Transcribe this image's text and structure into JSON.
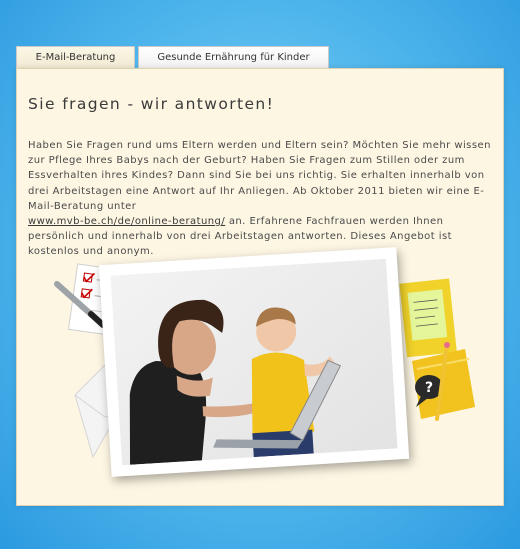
{
  "tabs": [
    {
      "label": "E-Mail-Beratung",
      "active": true
    },
    {
      "label": "Gesunde Ernährung für Kinder",
      "active": false
    }
  ],
  "main": {
    "heading": "Sie fragen - wir antworten!",
    "paragraph_before_link": "Haben Sie Fragen rund ums Eltern werden und Eltern sein?  Möchten Sie mehr wissen zur Pflege Ihres Babys nach der Geburt? Haben Sie Fragen zum Stillen oder zum Essverhalten ihres Kindes? Dann sind Sie bei uns richtig. Sie erhalten innerhalb von drei Arbeitstagen eine Antwort auf Ihr Anliegen. Ab Oktober 2011 bieten wir eine E-Mail-Beratung unter",
    "link_text": "www.mvb-be.ch/de/online-beratung/",
    "paragraph_after_link": " an. Erfahrene Fachfrauen werden Ihnen persönlich und innerhalb von drei Arbeitstagen antworten. Dieses Angebot ist kostenlos und anonym."
  },
  "colors": {
    "background": "#4fb6ec",
    "panel": "#fdf6e3",
    "text": "#4a4a4a"
  },
  "illustration": {
    "left_items": [
      "checklist-icon",
      "pen-icon",
      "envelope-icon"
    ],
    "right_items": [
      "sticky-note-icon",
      "question-bubble-icon",
      "pencil-icon"
    ],
    "photo": "photo-mother-child-laptop"
  }
}
